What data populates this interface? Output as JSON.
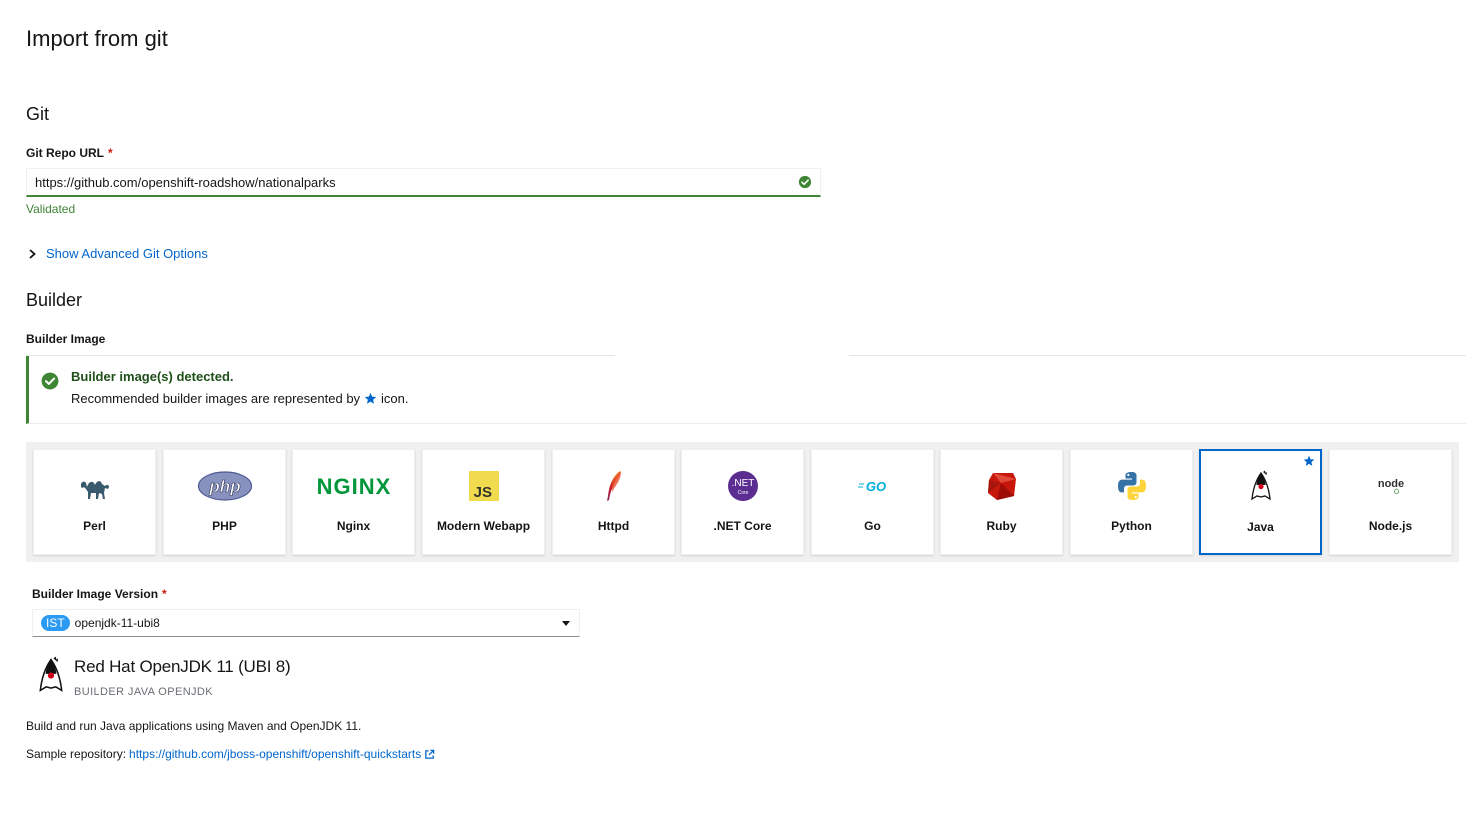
{
  "page": {
    "title": "Import from git"
  },
  "git": {
    "section_title": "Git",
    "repo_label": "Git Repo URL",
    "required_mark": "*",
    "repo_value": "https://github.com/openshift-roadshow/nationalparks",
    "helper_text": "Validated",
    "advanced_toggle": "Show Advanced Git Options"
  },
  "builder": {
    "section_title": "Builder",
    "image_label": "Builder Image",
    "alert_title": "Builder image(s) detected.",
    "alert_text_before": "Recommended builder images are represented by",
    "alert_text_after": "icon.",
    "tiles": [
      {
        "label": "Perl",
        "icon": "camel-icon"
      },
      {
        "label": "PHP",
        "icon": "php-icon"
      },
      {
        "label": "Nginx",
        "icon": "nginx-icon"
      },
      {
        "label": "Modern Webapp",
        "icon": "js-icon"
      },
      {
        "label": "Httpd",
        "icon": "feather-icon"
      },
      {
        "label": ".NET Core",
        "icon": "dotnet-icon"
      },
      {
        "label": "Go",
        "icon": "go-icon"
      },
      {
        "label": "Ruby",
        "icon": "ruby-icon"
      },
      {
        "label": "Python",
        "icon": "python-icon"
      },
      {
        "label": "Java",
        "icon": "duke-icon",
        "selected": true,
        "recommended": true
      },
      {
        "label": "Node.js",
        "icon": "nodejs-icon"
      }
    ],
    "version_label": "Builder Image Version",
    "version_badge": "IST",
    "version_value": "openjdk-11-ubi8",
    "card_title": "Red Hat OpenJDK 11 (UBI 8)",
    "card_tags": "BUILDER JAVA OPENJDK",
    "description": "Build and run Java applications using Maven and OpenJDK 11.",
    "sample_label": "Sample repository:",
    "sample_link": "https://github.com/jboss-openshift/openshift-quickstarts"
  },
  "colors": {
    "success": "#3e8635",
    "link": "#0066cc",
    "selected": "#0066cc",
    "required": "#c9190b"
  }
}
